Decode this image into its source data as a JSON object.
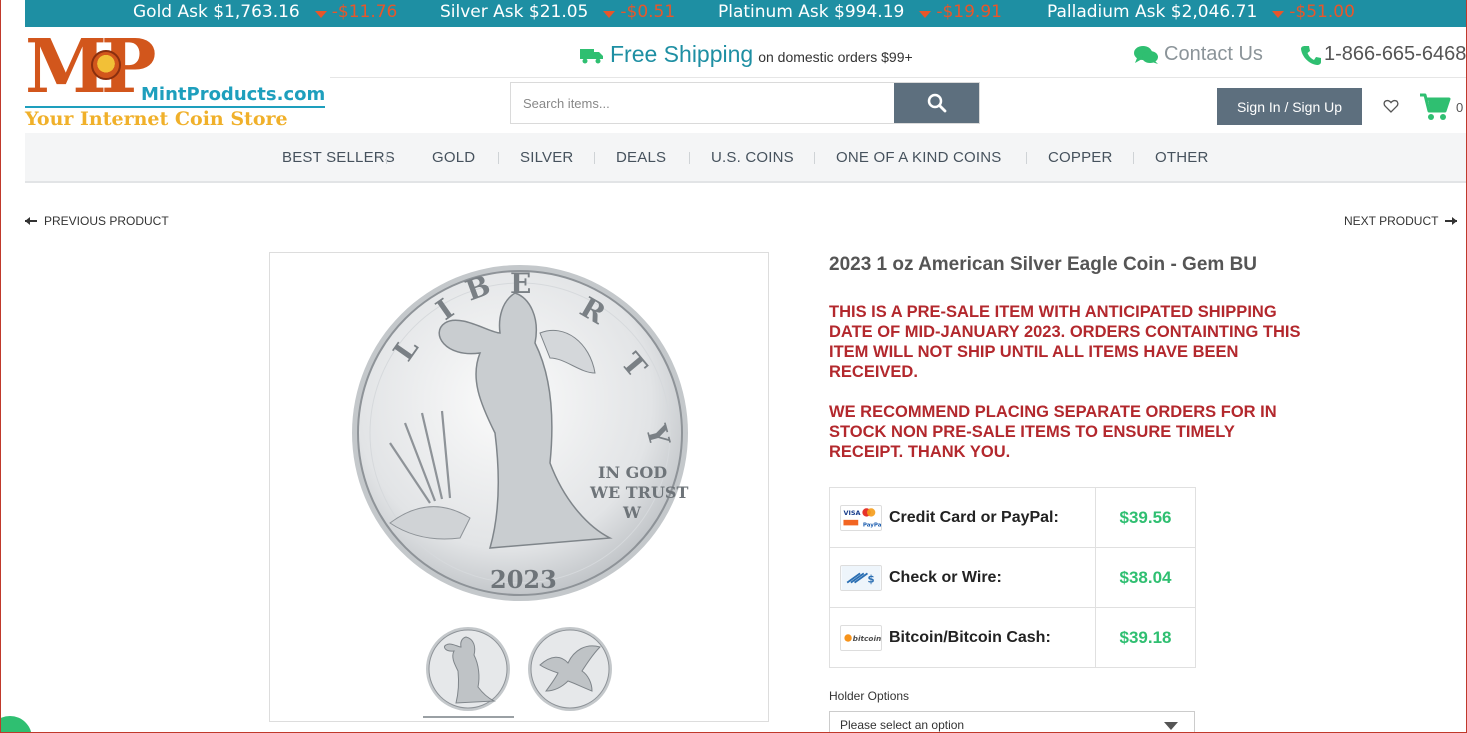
{
  "ticker": [
    {
      "label": "Gold Ask $1,763.16",
      "change": "-$11.76"
    },
    {
      "label": "Silver Ask $21.05",
      "change": "-$0.51"
    },
    {
      "label": "Platinum Ask $994.19",
      "change": "-$19.91"
    },
    {
      "label": "Palladium Ask $2,046.71",
      "change": "-$51.00"
    }
  ],
  "logo": {
    "letters": "MP",
    "domain": "MintProducts.com",
    "tagline": "Your Internet Coin Store"
  },
  "header": {
    "shipping_big": "Free Shipping",
    "shipping_small": "on domestic orders $99+",
    "contact": "Contact Us",
    "phone": "1-866-665-6468"
  },
  "search": {
    "placeholder": "Search items..."
  },
  "account": {
    "signin": "Sign In / Sign Up",
    "cart_count": "0"
  },
  "nav": [
    "BEST SELLERS",
    "GOLD",
    "SILVER",
    "DEALS",
    "U.S. COINS",
    "ONE OF A KIND COINS",
    "COPPER",
    "OTHER"
  ],
  "pager": {
    "prev": "PREVIOUS PRODUCT",
    "next": "NEXT PRODUCT"
  },
  "product": {
    "title": "2023 1 oz American Silver Eagle Coin - Gem BU",
    "notice_1": "THIS IS A PRE-SALE ITEM WITH ANTICIPATED SHIPPING DATE OF MID-JANUARY 2023.  ORDERS CONTAINTING THIS ITEM WILL NOT SHIP UNTIL ALL ITEMS HAVE BEEN RECEIVED.",
    "notice_2": "WE RECOMMEND PLACING SEPARATE ORDERS FOR IN STOCK NON PRE-SALE ITEMS TO ENSURE TIMELY RECEIPT.  THANK YOU.",
    "coin_text": {
      "liberty_l": "L",
      "liberty_i": "I",
      "liberty_b": "B",
      "liberty_e": "E",
      "liberty_r": "R",
      "liberty_t": "T",
      "liberty_y": "Y",
      "motto_1": "IN GOD",
      "motto_2": "WE TRUST",
      "mint": "W",
      "year": "2023"
    },
    "prices": [
      {
        "method": "Credit Card or PayPal:",
        "price": "$39.56",
        "icon": "credit-card-paypal-icon"
      },
      {
        "method": "Check or Wire:",
        "price": "$38.04",
        "icon": "check-wire-icon"
      },
      {
        "method": "Bitcoin/Bitcoin Cash:",
        "price": "$39.18",
        "icon": "bitcoin-icon"
      }
    ],
    "holder_label": "Holder Options",
    "holder_selected": "Please select an option"
  },
  "colors": {
    "ticker_bg": "#1e8fa3",
    "down": "#e8562a",
    "accent_green": "#2fbf71",
    "notice_red": "#b3282d",
    "button_slate": "#5d6f7e"
  }
}
